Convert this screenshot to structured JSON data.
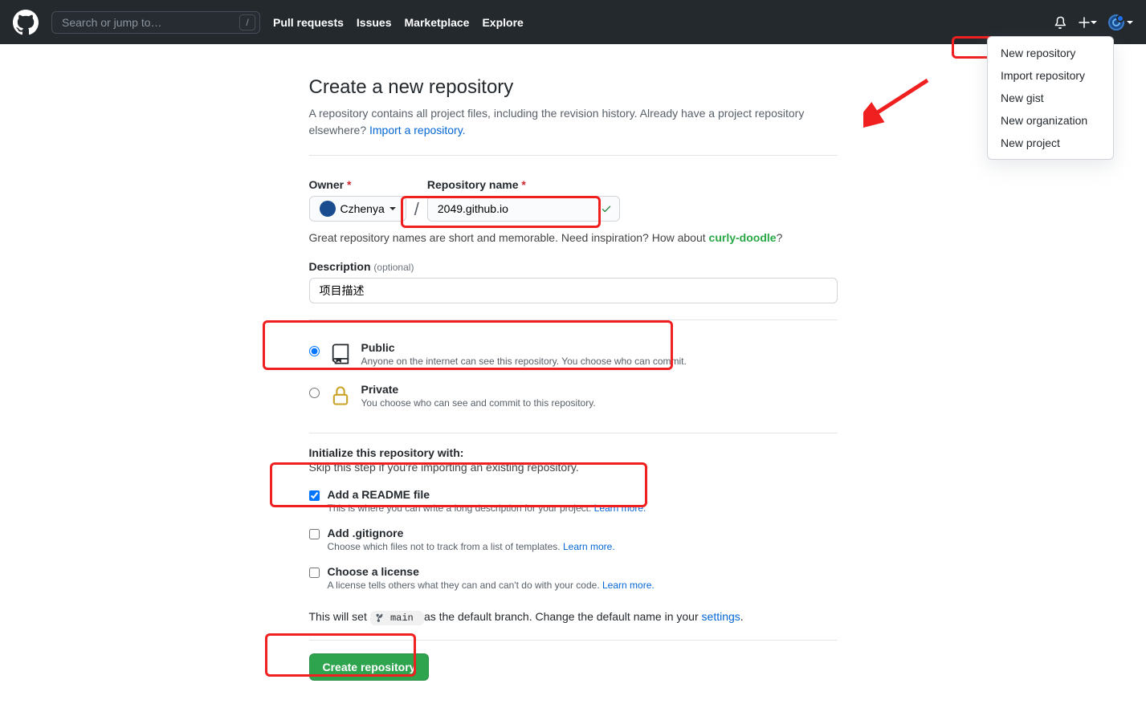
{
  "header": {
    "search_placeholder": "Search or jump to…",
    "slash": "/",
    "links": [
      "Pull requests",
      "Issues",
      "Marketplace",
      "Explore"
    ]
  },
  "dropdown": {
    "items": [
      "New repository",
      "Import repository",
      "New gist",
      "New organization",
      "New project"
    ]
  },
  "page": {
    "title": "Create a new repository",
    "subhead": "A repository contains all project files, including the revision history. Already have a project repository elsewhere? ",
    "import_link": "Import a repository."
  },
  "owner": {
    "label": "Owner",
    "value": "Czhenya"
  },
  "repo": {
    "label": "Repository name",
    "value": "2049.github.io"
  },
  "hint": {
    "text": "Great repository names are short and memorable. Need inspiration? How about ",
    "suggestion": "curly-doodle",
    "q": "?"
  },
  "description": {
    "label": "Description",
    "optional": "(optional)",
    "value": "项目描述"
  },
  "visibility": {
    "public": {
      "title": "Public",
      "desc": "Anyone on the internet can see this repository. You choose who can commit."
    },
    "private": {
      "title": "Private",
      "desc": "You choose who can see and commit to this repository."
    }
  },
  "init": {
    "title": "Initialize this repository with:",
    "sub": "Skip this step if you're importing an existing repository.",
    "readme": {
      "title": "Add a README file",
      "desc": "This is where you can write a long description for your project. ",
      "learn": "Learn more."
    },
    "gitignore": {
      "title": "Add .gitignore",
      "desc": "Choose which files not to track from a list of templates. ",
      "learn": "Learn more."
    },
    "license": {
      "title": "Choose a license",
      "desc": "A license tells others what they can and can't do with your code. ",
      "learn": "Learn more."
    }
  },
  "branch": {
    "prefix": "This will set ",
    "branch_name": "main",
    "middle": " as the default branch. Change the default name in your ",
    "settings": "settings",
    "dot": "."
  },
  "create_button": "Create repository"
}
